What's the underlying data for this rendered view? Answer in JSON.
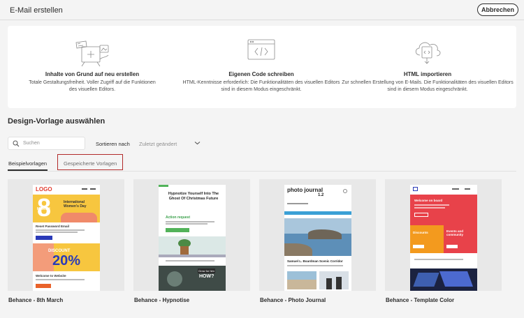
{
  "window": {
    "title": "E-Mail erstellen",
    "cancel_label": "Abbrechen"
  },
  "options": [
    {
      "title": "Inhalte von Grund auf neu erstellen",
      "desc_line1": "Totale Gestaltungsfreiheit. Voller Zugriff auf die Funktionen",
      "desc_line2": "des visuellen Editors."
    },
    {
      "title": "Eigenen Code schreiben",
      "desc_line1": "HTML-Kenntnisse erforderlich: Die Funktionalitäten des visuellen Editors",
      "desc_line2": "sind in diesem Modus eingeschränkt."
    },
    {
      "title": "HTML importieren",
      "desc_line1": "Zur schnellen Erstellung von E-Mails. Die Funktionalitäten des visuellen Editors",
      "desc_line2": "sind in diesem Modus eingeschränkt."
    }
  ],
  "section": {
    "title": "Design-Vorlage auswählen"
  },
  "search": {
    "placeholder": "Suchen"
  },
  "sort": {
    "label": "Sortieren nach",
    "value": "Zuletzt geändert"
  },
  "tabs": [
    {
      "label": "Beispielvorlagen",
      "active": true
    },
    {
      "label": "Gespeicherte Vorlagen",
      "active": false
    }
  ],
  "templates": [
    {
      "name": "Behance - 8th March",
      "logo": "LOGO",
      "t_march": "8",
      "t_march_word": "MARCH",
      "t_headline": "International Women's Day",
      "t_reset": "Reset Password Email",
      "t_discount": "DISCOUNT",
      "t_pct": "20%",
      "t_welcome": "Welcome to Website"
    },
    {
      "name": "Behance - Hypnotise",
      "t_headline": "Hypnotize Yourself Into The Ghost Of Christmas Future",
      "t_action": "Action request",
      "t_grow": "Grow for him",
      "t_how": "HOW?"
    },
    {
      "name": "Behance - Photo Journal",
      "t_title": "photo journal",
      "t_issue": "1.2",
      "t_story": "Samuel L. Boardman Scenic Corridor"
    },
    {
      "name": "Behance - Template Color",
      "t_welcome": "Welcome on board",
      "t_discounts": "Discounts",
      "t_events": "Events and community"
    }
  ],
  "colors": {
    "accent_red": "#b22a2a",
    "text": "#2c2c2c",
    "card_bg": "#e8e8e8"
  }
}
